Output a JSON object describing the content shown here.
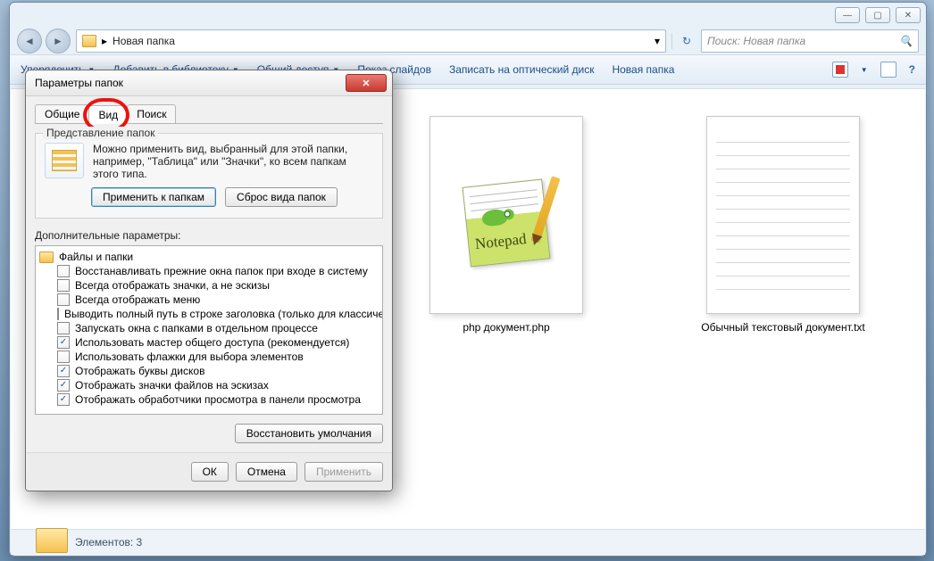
{
  "window": {
    "path_label": "Новая папка",
    "search_placeholder": "Поиск: Новая папка",
    "win_min": "—",
    "win_max": "▢",
    "win_close": "✕",
    "nav_back": "◄",
    "nav_fwd": "►",
    "refresh": "↻"
  },
  "toolbar": {
    "organize": "Упорядочить",
    "include": "Добавить в библиотеку",
    "share": "Общий доступ",
    "slideshow": "Показ слайдов",
    "burn": "Записать на оптический диск",
    "newfolder": "Новая папка",
    "help": "?"
  },
  "files": [
    {
      "name": "php документ.php",
      "kind": "notepadpp"
    },
    {
      "name": "Обычный текстовый документ.txt",
      "kind": "text"
    }
  ],
  "status": {
    "text": "Элементов: 3"
  },
  "dialog": {
    "title": "Параметры папок",
    "close_glyph": "✕",
    "tabs": {
      "general": "Общие",
      "view": "Вид",
      "search": "Поиск",
      "active": "view"
    },
    "folderviews": {
      "legend": "Представление папок",
      "desc": "Можно применить вид, выбранный для этой папки, например, \"Таблица\" или \"Значки\", ко всем папкам этого типа.",
      "apply": "Применить к папкам",
      "reset": "Сброс вида папок"
    },
    "adv_label": "Дополнительные параметры:",
    "tree_root": "Файлы и папки",
    "options": [
      {
        "checked": false,
        "label": "Восстанавливать прежние окна папок при входе в систему"
      },
      {
        "checked": false,
        "label": "Всегда отображать значки, а не эскизы"
      },
      {
        "checked": false,
        "label": "Всегда отображать меню"
      },
      {
        "checked": false,
        "label": "Выводить полный путь в строке заголовка (только для классической темы)"
      },
      {
        "checked": false,
        "label": "Запускать окна с папками в отдельном процессе"
      },
      {
        "checked": true,
        "label": "Использовать мастер общего доступа (рекомендуется)"
      },
      {
        "checked": false,
        "label": "Использовать флажки для выбора элементов"
      },
      {
        "checked": true,
        "label": "Отображать буквы дисков"
      },
      {
        "checked": true,
        "label": "Отображать значки файлов на эскизах"
      },
      {
        "checked": true,
        "label": "Отображать обработчики просмотра в панели просмотра"
      }
    ],
    "restore": "Восстановить умолчания",
    "ok": "ОК",
    "cancel": "Отмена",
    "apply_btn": "Применить"
  }
}
